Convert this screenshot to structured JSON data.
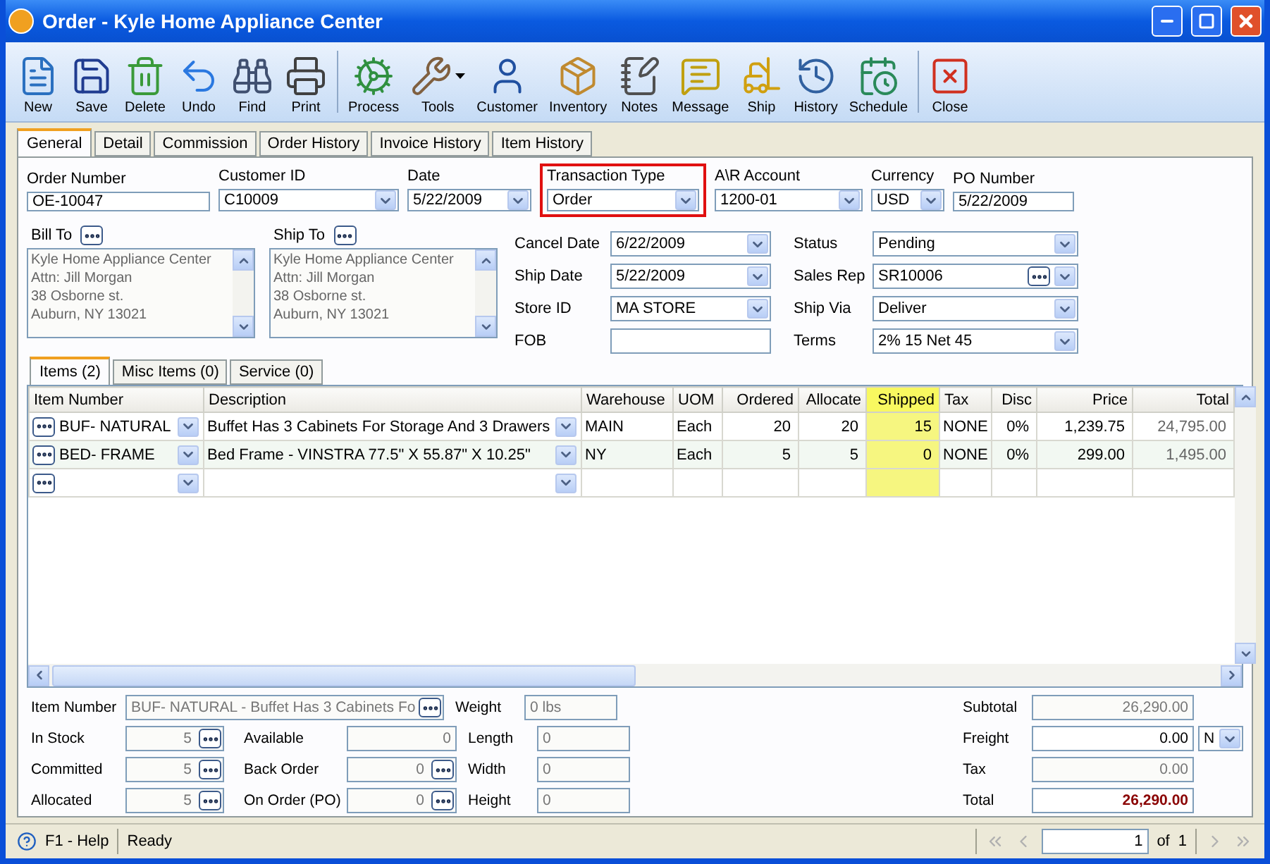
{
  "window": {
    "title": "Order - Kyle Home Appliance Center"
  },
  "toolbar": {
    "groups": [
      [
        {
          "label": "New",
          "dropdown": false
        },
        {
          "label": "Save",
          "dropdown": false
        },
        {
          "label": "Delete",
          "dropdown": false
        },
        {
          "label": "Undo",
          "dropdown": false
        },
        {
          "label": "Find",
          "dropdown": false
        },
        {
          "label": "Print",
          "dropdown": false
        }
      ],
      [
        {
          "label": "Process",
          "dropdown": false
        },
        {
          "label": "Tools",
          "dropdown": true
        },
        {
          "label": "Customer",
          "dropdown": false
        },
        {
          "label": "Inventory",
          "dropdown": false
        },
        {
          "label": "Notes",
          "dropdown": false
        },
        {
          "label": "Message",
          "dropdown": false
        },
        {
          "label": "Ship",
          "dropdown": false
        },
        {
          "label": "History",
          "dropdown": false
        },
        {
          "label": "Schedule",
          "dropdown": false
        }
      ],
      [
        {
          "label": "Close",
          "dropdown": false
        }
      ]
    ]
  },
  "tabs": [
    {
      "label": "General",
      "selected": true
    },
    {
      "label": "Detail",
      "selected": false
    },
    {
      "label": "Commission",
      "selected": false
    },
    {
      "label": "Order History",
      "selected": false
    },
    {
      "label": "Invoice History",
      "selected": false
    },
    {
      "label": "Item History",
      "selected": false
    }
  ],
  "header_fields": [
    {
      "label": "Order Number",
      "value": "OE-10047",
      "kind": "text",
      "highlighted": false
    },
    {
      "label": "Customer ID",
      "value": "C10009",
      "kind": "combo",
      "highlighted": false
    },
    {
      "label": "Date",
      "value": "5/22/2009",
      "kind": "combo",
      "highlighted": false
    },
    {
      "label": "Transaction Type",
      "value": "Order",
      "kind": "combo",
      "highlighted": true
    },
    {
      "label": "A\\R Account",
      "value": "1200-01",
      "kind": "combo",
      "highlighted": false
    },
    {
      "label": "Currency",
      "value": "USD",
      "kind": "combo",
      "highlighted": false
    },
    {
      "label": "PO Number",
      "value": "5/22/2009",
      "kind": "text",
      "highlighted": false
    }
  ],
  "addresses": [
    {
      "label": "Bill To",
      "lines": [
        "Kyle Home Appliance Center",
        "Attn: Jill Morgan",
        "38 Osborne st.",
        "Auburn, NY 13021"
      ]
    },
    {
      "label": "Ship To",
      "lines": [
        "Kyle Home Appliance Center",
        "Attn: Jill Morgan",
        "38 Osborne st.",
        "Auburn, NY 13021"
      ]
    }
  ],
  "details": [
    {
      "label": "Cancel  Date",
      "value": "6/22/2009",
      "kind": "combo"
    },
    {
      "label": "Status",
      "value": "Pending",
      "kind": "combo"
    },
    {
      "label": "Ship Date",
      "value": "5/22/2009",
      "kind": "combo"
    },
    {
      "label": "Sales Rep",
      "value": "SR10006",
      "kind": "lookup_combo"
    },
    {
      "label": "Store ID",
      "value": "MA STORE",
      "kind": "combo"
    },
    {
      "label": "Ship Via",
      "value": "Deliver",
      "kind": "combo"
    },
    {
      "label": "FOB",
      "kind": "text"
    },
    {
      "label": "Terms",
      "value": "2% 15 Net 45",
      "kind": "combo"
    }
  ],
  "item_tabs": [
    {
      "label": "Items (2)",
      "selected": true
    },
    {
      "label": "Misc Items (0)",
      "selected": false
    },
    {
      "label": "Service (0)",
      "selected": false
    }
  ],
  "grid": {
    "columns": [
      {
        "label": "Item Number",
        "kind": "lookup",
        "highlighted": false
      },
      {
        "label": "Description",
        "kind": "combo",
        "highlighted": false
      },
      {
        "label": "Warehouse",
        "kind": "text",
        "highlighted": false
      },
      {
        "label": "UOM",
        "kind": "text",
        "highlighted": false
      },
      {
        "label": "Ordered",
        "kind": "number",
        "highlighted": false
      },
      {
        "label": "Allocate",
        "kind": "number",
        "highlighted": false
      },
      {
        "label": "Shipped",
        "kind": "number",
        "highlighted": true
      },
      {
        "label": "Tax",
        "kind": "text",
        "highlighted": false
      },
      {
        "label": "Disc",
        "kind": "number",
        "highlighted": false
      },
      {
        "label": "Price",
        "kind": "number",
        "highlighted": false
      },
      {
        "label": "Total",
        "kind": "total",
        "highlighted": false
      }
    ],
    "rows": [
      [
        "BUF- NATURAL",
        "Buffet Has 3 Cabinets For Storage And 3 Drawers",
        "MAIN",
        "Each",
        "20",
        "20",
        "15",
        "NONE",
        "0%",
        "1,239.75",
        "24,795.00"
      ],
      [
        "BED- FRAME",
        "Bed Frame - VINSTRA 77.5\" X 55.87\" X 10.25\"",
        "NY",
        "Each",
        "5",
        "5",
        "0",
        "NONE",
        "0%",
        "299.00",
        "1,495.00"
      ]
    ]
  },
  "bottom": {
    "item_number": {
      "label": "Item Number",
      "value": "BUF- NATURAL - Buffet Has 3 Cabinets Fo"
    },
    "stock": [
      {
        "label": "In Stock",
        "value": "5"
      },
      {
        "label": "Committed",
        "value": "5"
      },
      {
        "label": "Allocated",
        "value": "5"
      }
    ],
    "availability": [
      {
        "label": "Available",
        "value": "0",
        "kind": "text"
      },
      {
        "label": "Back Order",
        "value": "0",
        "kind": "lookup"
      },
      {
        "label": "On Order (PO)",
        "value": "0",
        "kind": "lookup"
      }
    ],
    "measures": [
      {
        "label": "Weight",
        "value": "0 lbs"
      },
      {
        "label": "Length",
        "value": "0"
      },
      {
        "label": "Width",
        "value": "0"
      },
      {
        "label": "Height",
        "value": "0"
      }
    ],
    "totals": [
      {
        "label": "Subtotal",
        "value": "26,290.00",
        "kind": "plain"
      },
      {
        "label": "Freight",
        "value": "0.00",
        "kind": "plain",
        "option": "N"
      },
      {
        "label": "Tax",
        "value": "0.00",
        "kind": "plain"
      },
      {
        "label": "Total",
        "value": "26,290.00",
        "kind": "grand"
      }
    ]
  },
  "status_bar": {
    "help": "F1 - Help",
    "status": "Ready",
    "page": "1",
    "of": "of",
    "total": "1"
  }
}
